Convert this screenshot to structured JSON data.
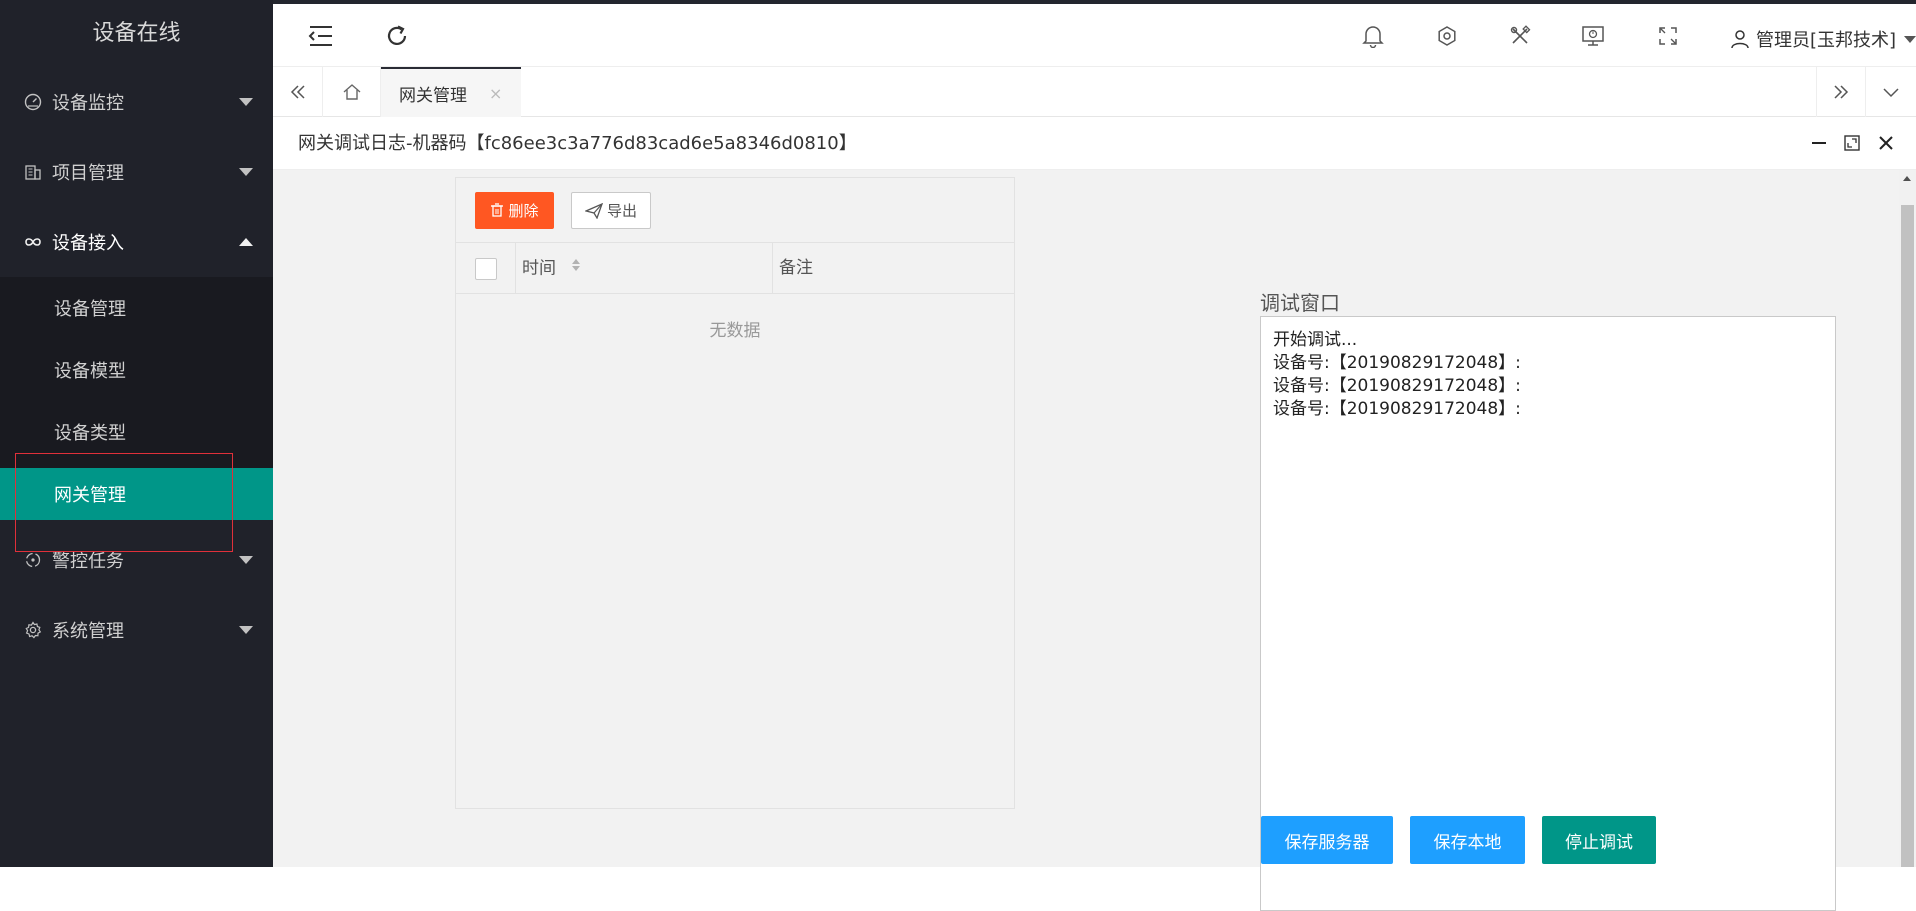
{
  "sidebar": {
    "logo": "设备在线",
    "menu": [
      {
        "label": "设备监控",
        "icon": "gauge-icon"
      },
      {
        "label": "项目管理",
        "icon": "building-icon"
      },
      {
        "label": "设备接入",
        "icon": "infinity-icon"
      },
      {
        "label": "警控任务",
        "icon": "target-icon"
      },
      {
        "label": "系统管理",
        "icon": "gear-icon"
      }
    ],
    "submenu": [
      "设备管理",
      "设备模型",
      "设备类型",
      "网关管理"
    ]
  },
  "header": {
    "user": "管理员[玉邦技术]"
  },
  "tabs": {
    "active": "网关管理",
    "close": "×"
  },
  "layer": {
    "title": "网关调试日志-机器码【fc86ee3c3a776d83cad6e5a8346d0810】"
  },
  "table": {
    "delete_label": "删除",
    "export_label": "导出",
    "columns": [
      "时间",
      "备注"
    ],
    "empty_text": "无数据"
  },
  "debug": {
    "label": "调试窗口",
    "lines": [
      "开始调试...",
      "设备号:【20190829172048】:",
      "设备号:【20190829172048】:",
      "设备号:【20190829172048】:"
    ]
  },
  "buttons": {
    "save_server": "保存服务器",
    "save_local": "保存本地",
    "stop_debug": "停止调试"
  },
  "colors": {
    "sidebar_bg": "#20222a",
    "active_green": "#009688",
    "danger_orange": "#ff5722",
    "primary_blue": "#1e9fff"
  }
}
